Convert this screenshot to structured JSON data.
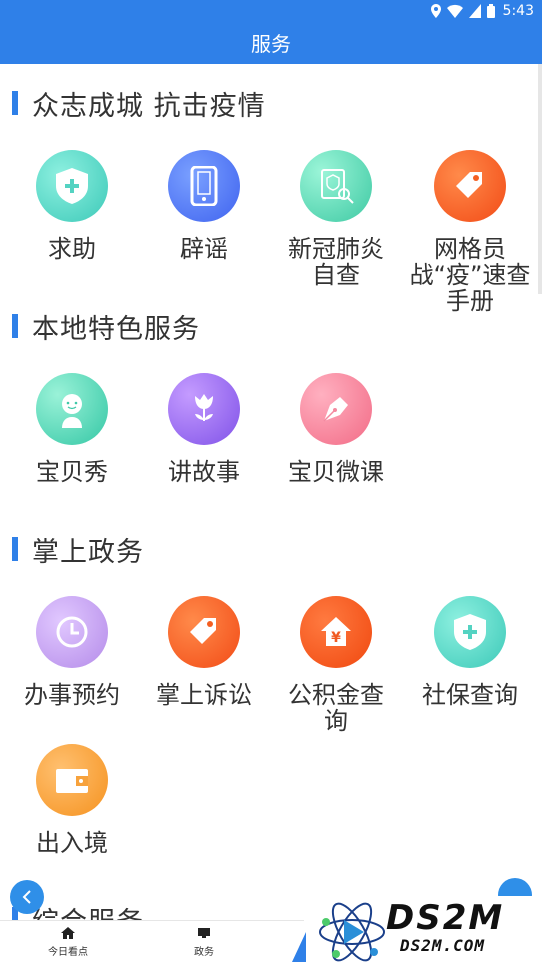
{
  "status_bar": {
    "time": "5:43"
  },
  "header": {
    "title": "服务"
  },
  "sections": [
    {
      "title": "众志成城 抗击疫情",
      "items": [
        {
          "label": "求助",
          "icon": "shield-plus-icon"
        },
        {
          "label": "辟谣",
          "icon": "phone-icon"
        },
        {
          "label": "新冠肺炎\n自查",
          "icon": "medical-search-icon"
        },
        {
          "label": "网格员\n战“疫”速查\n手册",
          "icon": "tag-icon"
        }
      ]
    },
    {
      "title": "本地特色服务",
      "items": [
        {
          "label": "宝贝秀",
          "icon": "child-face-icon"
        },
        {
          "label": "讲故事",
          "icon": "flower-icon"
        },
        {
          "label": "宝贝微课",
          "icon": "pen-icon"
        }
      ]
    },
    {
      "title": "掌上政务",
      "items": [
        {
          "label": "办事预约",
          "icon": "clock-icon"
        },
        {
          "label": "掌上诉讼",
          "icon": "tag-icon"
        },
        {
          "label": "公积金查\n询",
          "icon": "house-yuan-icon"
        },
        {
          "label": "社保查询",
          "icon": "shield-plus-icon"
        },
        {
          "label": "出入境",
          "icon": "wallet-icon"
        }
      ]
    },
    {
      "title": "综合服务"
    }
  ],
  "tabs": [
    {
      "label": "今日看点",
      "icon": "home-icon"
    },
    {
      "label": "政务",
      "icon": "monitor-icon"
    }
  ],
  "watermark": {
    "big": "DS2M",
    "small": "DS2M.COM"
  },
  "colors": {
    "primary": "#2f80e8"
  }
}
